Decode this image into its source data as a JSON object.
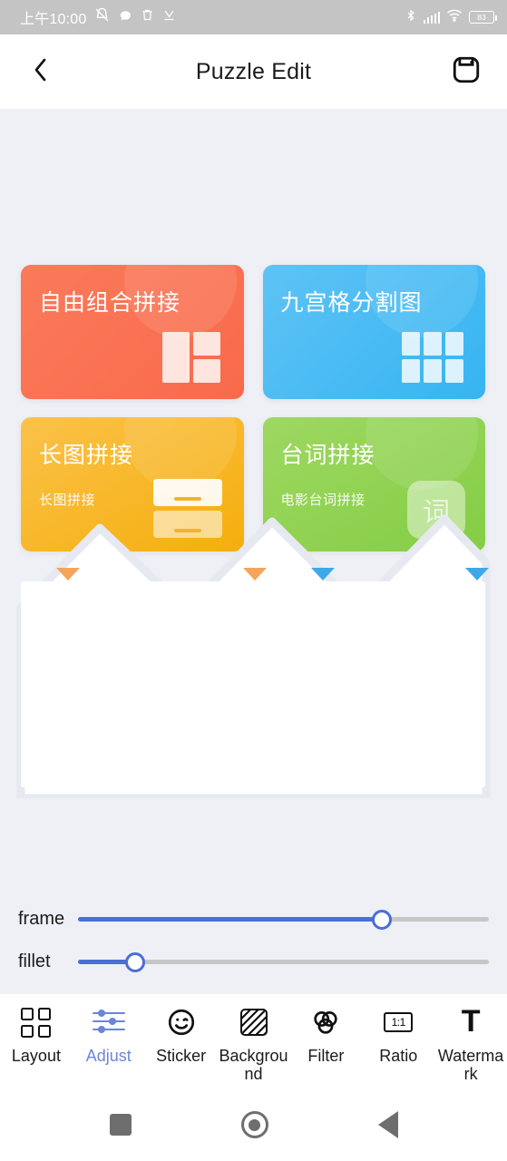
{
  "status_bar": {
    "time": "上午10:00",
    "battery_percent": "83",
    "left_icons": [
      "bell-muted-icon",
      "chat-bubble-icon",
      "trash-icon",
      "download-icon"
    ],
    "right_icons": [
      "bluetooth-icon",
      "signal-bars-icon",
      "wifi-icon",
      "battery-icon"
    ]
  },
  "header": {
    "back_icon": "chevron-left-icon",
    "title": "Puzzle Edit",
    "save_icon": "save-icon"
  },
  "cards": [
    {
      "title": "自由组合拼接",
      "subtitle": "",
      "icon": "collage-grid-icon",
      "color": "#f96a4c",
      "variant": "card-red"
    },
    {
      "title": "九宫格分割图",
      "subtitle": "",
      "icon": "nine-grid-icon",
      "color": "#36b4f2",
      "variant": "card-blue"
    },
    {
      "title": "长图拼接",
      "subtitle": "长图拼接",
      "icon": "stacked-panels-icon",
      "color": "#f5ae0c",
      "variant": "card-yellow"
    },
    {
      "title": "台词拼接",
      "subtitle": "电影台词拼接",
      "icon": "word-badge-icon",
      "badge_text": "词",
      "color": "#84cd45",
      "variant": "card-green"
    }
  ],
  "sliders": [
    {
      "label": "frame",
      "value": 74
    },
    {
      "label": "fillet",
      "value": 14
    }
  ],
  "toolbar": {
    "active": "Adjust",
    "items": [
      {
        "label": "Layout",
        "icon": "layout-grid-icon"
      },
      {
        "label": "Adjust",
        "icon": "sliders-icon"
      },
      {
        "label": "Sticker",
        "icon": "smiley-icon"
      },
      {
        "label": "Background",
        "icon": "hatched-square-icon"
      },
      {
        "label": "Filter",
        "icon": "three-circles-icon"
      },
      {
        "label": "Ratio",
        "icon": "aspect-ratio-icon"
      },
      {
        "label": "Watermark",
        "icon": "text-t-icon"
      }
    ]
  },
  "nav_bar": {
    "recents_icon": "square-icon",
    "home_icon": "circle-icon",
    "back_icon": "triangle-left-icon"
  },
  "colors": {
    "accent": "#4a6fd4",
    "active_label": "#6b85dc",
    "background": "#eef0f5",
    "status_bar": "#c4c4c4"
  }
}
